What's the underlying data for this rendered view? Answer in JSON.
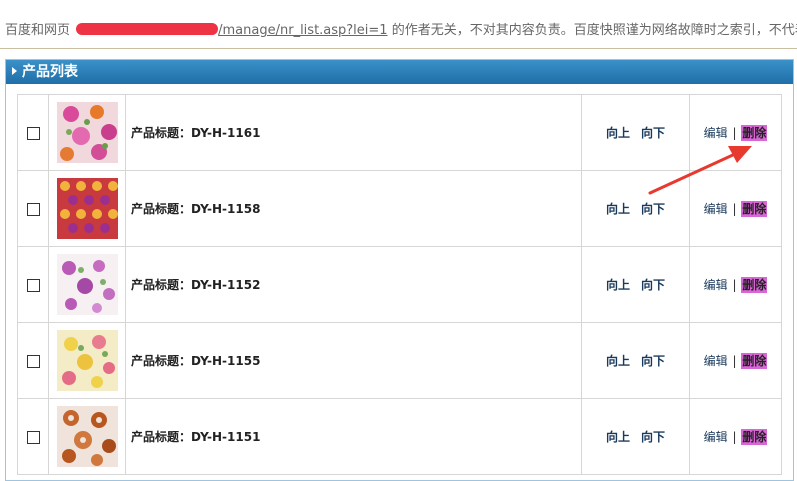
{
  "snapshot_bar": {
    "prefix": "百度和网页 ",
    "link_tail": "/manage/nr_list.asp?lei=1",
    "suffix": " 的作者无关，不对其内容负责。百度快照谨为网络故障时之索引，不代表被"
  },
  "panel": {
    "title": "产品列表"
  },
  "colors": {
    "header_blue": "#2a82bd",
    "highlight": "#d966d6",
    "arrow_red": "#e8392f"
  },
  "rows": [
    {
      "title": "产品标题：DY-H-1161",
      "up": "向上",
      "down": "向下",
      "edit": "编辑",
      "sep": "|",
      "del": "删除",
      "swatch": "floral-pink"
    },
    {
      "title": "产品标题：DY-H-1158",
      "up": "向上",
      "down": "向下",
      "edit": "编辑",
      "sep": "|",
      "del": "删除",
      "swatch": "red-dotted"
    },
    {
      "title": "产品标题：DY-H-1152",
      "up": "向上",
      "down": "向下",
      "edit": "编辑",
      "sep": "|",
      "del": "删除",
      "swatch": "floral-white-purple"
    },
    {
      "title": "产品标题：DY-H-1155",
      "up": "向上",
      "down": "向下",
      "edit": "编辑",
      "sep": "|",
      "del": "删除",
      "swatch": "floral-yellow"
    },
    {
      "title": "产品标题：DY-H-1151",
      "up": "向上",
      "down": "向下",
      "edit": "编辑",
      "sep": "|",
      "del": "删除",
      "swatch": "floral-orange"
    }
  ]
}
